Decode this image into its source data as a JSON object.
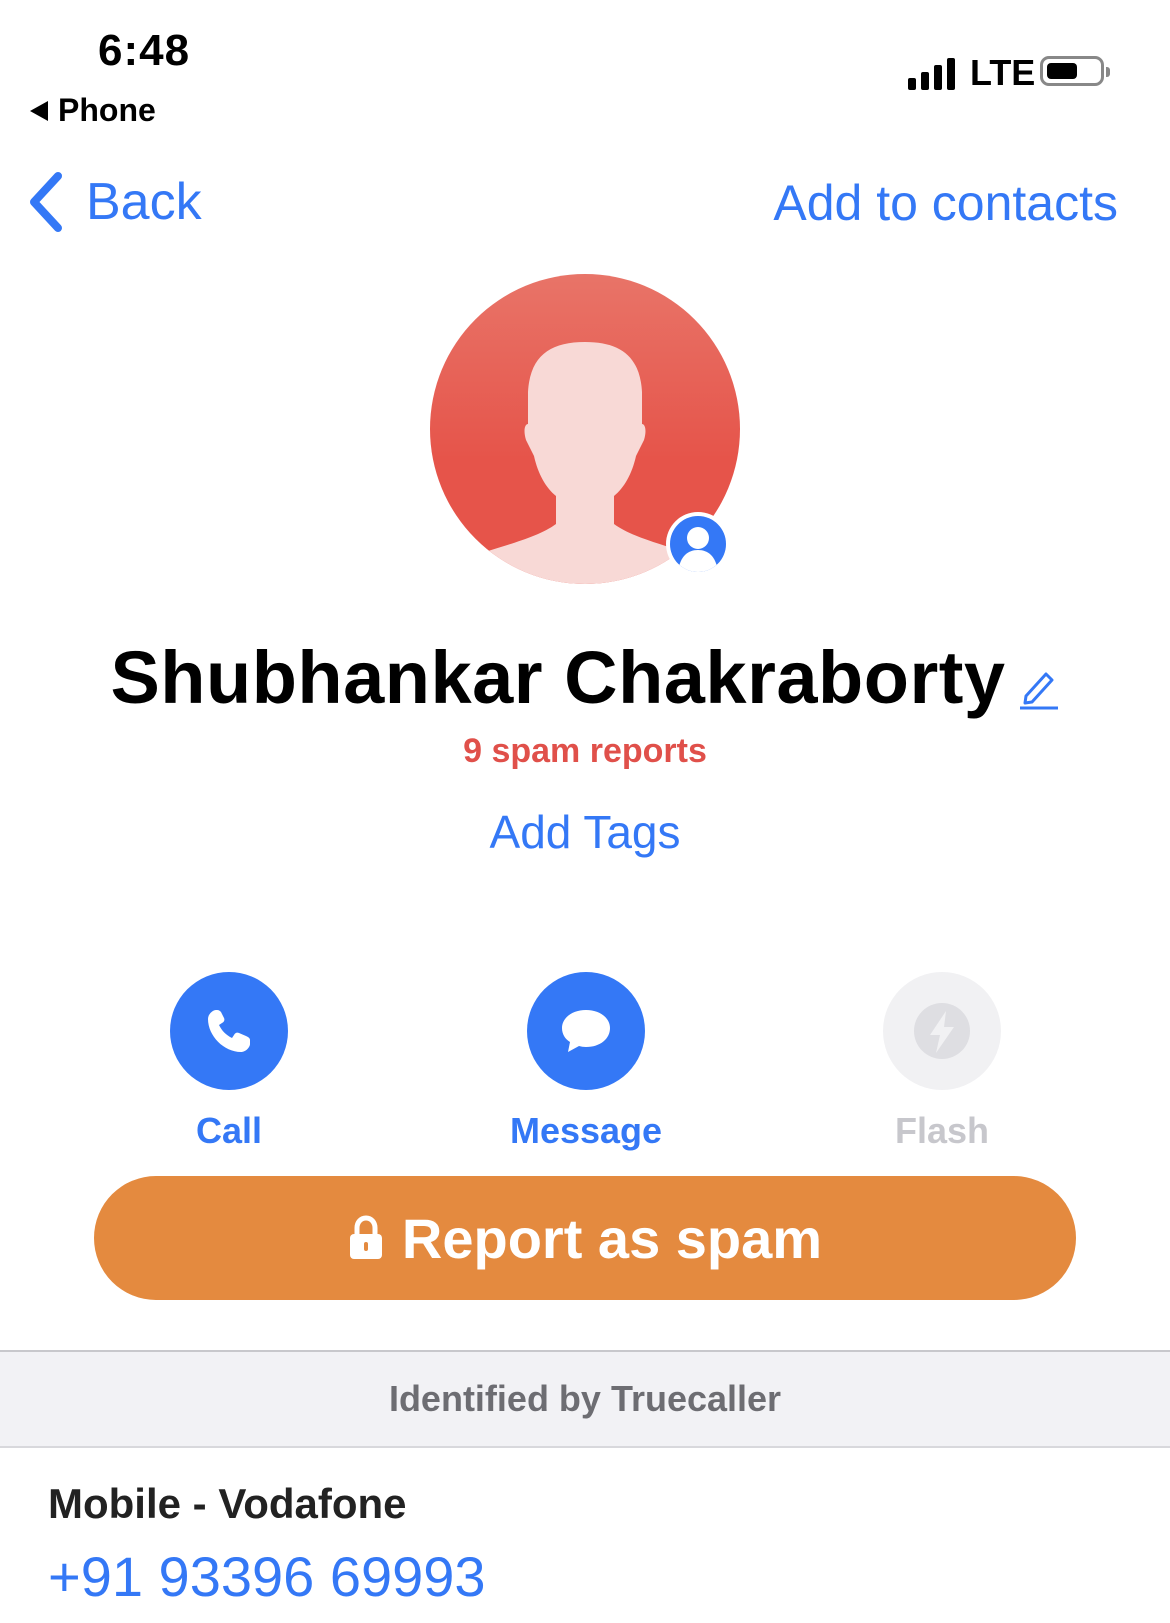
{
  "status_bar": {
    "time": "6:48",
    "back_app": "Phone",
    "network": "LTE"
  },
  "nav": {
    "back_label": "Back",
    "add_contacts_label": "Add to contacts"
  },
  "profile": {
    "name": "Shubhankar Chakraborty",
    "spam_reports": "9 spam reports",
    "add_tags": "Add Tags"
  },
  "actions": [
    {
      "label": "Call",
      "icon": "phone-icon",
      "enabled": true
    },
    {
      "label": "Message",
      "icon": "chat-bubble-icon",
      "enabled": true
    },
    {
      "label": "Flash",
      "icon": "flash-icon",
      "enabled": false
    }
  ],
  "report_button": {
    "label": "Report as spam",
    "icon": "lock-icon"
  },
  "identified_banner": "Identified by Truecaller",
  "phone": {
    "type_label": "Mobile - Vodafone",
    "number": "+91 93396 69993"
  },
  "colors": {
    "accent": "#3478F6",
    "spam_red": "#E0504A",
    "report_orange": "#E48A3F",
    "avatar_red": "#E6544A",
    "disabled": "#C7C7CC"
  }
}
